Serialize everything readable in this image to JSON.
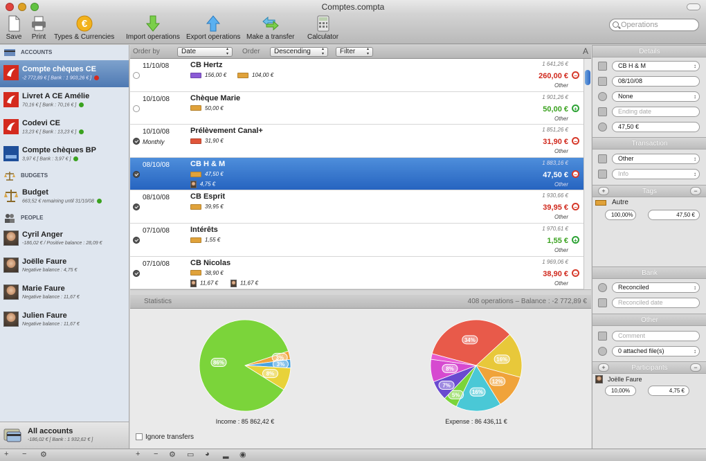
{
  "window": {
    "title": "Comptes.compta"
  },
  "toolbar": {
    "items": [
      {
        "label": "Save",
        "icon": "save-icon"
      },
      {
        "label": "Print",
        "icon": "print-icon"
      },
      {
        "label": "Types & Currencies",
        "icon": "euro-icon"
      },
      {
        "label": "Import operations",
        "icon": "import-arrow-icon"
      },
      {
        "label": "Export operations",
        "icon": "export-arrow-icon"
      },
      {
        "label": "Make a transfer",
        "icon": "transfer-arrows-icon"
      },
      {
        "label": "Calculator",
        "icon": "calculator-icon"
      }
    ],
    "search_placeholder": "Operations"
  },
  "sidebar": {
    "sections": {
      "accounts": "ACCOUNTS",
      "budgets": "BUDGETS",
      "people": "PEOPLE"
    },
    "accounts": [
      {
        "name": "Compte chèques CE",
        "sub": "-2 772,89 € [ Bank : 1 903,26 € ]",
        "status": "#d52a1e"
      },
      {
        "name": "Livret A CE Amélie",
        "sub": "70,16 € [ Bank : 70,16 € ]",
        "status": "#3aa21f"
      },
      {
        "name": "Codevi CE",
        "sub": "13,23 € [ Bank : 13,23 € ]",
        "status": "#3aa21f"
      },
      {
        "name": "Compte chèques BP",
        "sub": "3,97 € [ Bank : 3,97 € ]",
        "status": "#3aa21f"
      }
    ],
    "budgets": [
      {
        "name": "Budget",
        "sub": "663,52 € remaining until 31/10/08",
        "status": "#3aa21f"
      }
    ],
    "people": [
      {
        "name": "Cyril Anger",
        "sub": "-186,02 € / Positive balance : 28,09 €"
      },
      {
        "name": "Joëlle Faure",
        "sub": "Negative balance : 4,75 €"
      },
      {
        "name": "Marie Faure",
        "sub": "Negative balance : 11,67 €"
      },
      {
        "name": "Julien Faure",
        "sub": "Negative balance : 11,67 €"
      }
    ],
    "all_accounts": {
      "name": "All accounts",
      "sub": "-186,02 € [ Bank : 1 932,62 € ]"
    }
  },
  "list_header": {
    "order_by_label": "Order by",
    "order_by_value": "Date",
    "order_label": "Order",
    "order_value": "Descending",
    "filter_label": "Filter"
  },
  "operations": [
    {
      "date": "11/10/08",
      "recur": "",
      "title": "CB Hertz",
      "tags": [
        {
          "color": "#8b5bd6",
          "amount": "156,00 €"
        },
        {
          "color": "#e0a23a",
          "amount": "104,00 €"
        }
      ],
      "balance": "1 641,26 €",
      "amount": "260,00 €",
      "sign": "−",
      "kind": "neg",
      "category": "Other",
      "state": "open"
    },
    {
      "date": "10/10/08",
      "recur": "",
      "title": "Chèque Marie",
      "tags": [
        {
          "color": "#e0a23a",
          "amount": "50,00 €"
        }
      ],
      "balance": "1 901,26 €",
      "amount": "50,00 €",
      "sign": "+",
      "kind": "pos",
      "category": "Other",
      "state": "open"
    },
    {
      "date": "10/10/08",
      "recur": "Monthly",
      "title": "Prélèvement Canal+",
      "tags": [
        {
          "color": "#e0553a",
          "amount": "31,90 €"
        }
      ],
      "balance": "1 851,26 €",
      "amount": "31,90 €",
      "sign": "−",
      "kind": "neg",
      "category": "Other",
      "state": "done"
    },
    {
      "date": "08/10/08",
      "recur": "",
      "title": "CB H & M",
      "tags": [
        {
          "color": "#e0a23a",
          "amount": "47,50 €"
        }
      ],
      "people": [
        "4,75 €"
      ],
      "balance": "1 883,16 €",
      "amount": "47,50 €",
      "sign": "−",
      "kind": "neg",
      "category": "Other",
      "state": "done",
      "selected": true
    },
    {
      "date": "08/10/08",
      "recur": "",
      "title": "CB Esprit",
      "tags": [
        {
          "color": "#e0a23a",
          "amount": "39,95 €"
        }
      ],
      "balance": "1 930,66 €",
      "amount": "39,95 €",
      "sign": "−",
      "kind": "neg",
      "category": "Other",
      "state": "done"
    },
    {
      "date": "07/10/08",
      "recur": "",
      "title": "Intérêts",
      "tags": [
        {
          "color": "#e0a23a",
          "amount": "1,55 €"
        }
      ],
      "balance": "1 970,61 €",
      "amount": "1,55 €",
      "sign": "+",
      "kind": "pos",
      "category": "Other",
      "state": "done"
    },
    {
      "date": "07/10/08",
      "recur": "",
      "title": "CB Nicolas",
      "tags": [
        {
          "color": "#e0a23a",
          "amount": "38,90 €"
        }
      ],
      "people": [
        "11,67 €",
        "11,67 €"
      ],
      "balance": "1 969,06 €",
      "amount": "38,90 €",
      "sign": "−",
      "kind": "neg",
      "category": "Other",
      "state": "done"
    }
  ],
  "stats": {
    "title": "Statistics",
    "summary": "408 operations – Balance : -2 772,89 €",
    "income": {
      "caption": "Income : 85 862,42 €",
      "slices": [
        {
          "pct": 86,
          "label": "86%",
          "color": "#7bd43a"
        },
        {
          "pct": 3,
          "label": "3%",
          "color": "#f0a33a"
        },
        {
          "pct": 3,
          "label": "3%",
          "color": "#4aa3e0"
        },
        {
          "pct": 8,
          "label": "8%",
          "color": "#e8d23a"
        }
      ]
    },
    "expense": {
      "caption": "Expense : 86 436,11 €",
      "slices": [
        {
          "pct": 34,
          "label": "34%",
          "color": "#e85a4a"
        },
        {
          "pct": 16,
          "label": "16%",
          "color": "#e8c83a"
        },
        {
          "pct": 12,
          "label": "12%",
          "color": "#f0a33a"
        },
        {
          "pct": 16,
          "label": "16%",
          "color": "#4ac8d6"
        },
        {
          "pct": 5,
          "label": "5%",
          "color": "#7bd43a"
        },
        {
          "pct": 7,
          "label": "7%",
          "color": "#6a4ad0"
        },
        {
          "pct": 8,
          "label": "8%",
          "color": "#d64ad0"
        },
        {
          "pct": 2,
          "label": "",
          "color": "#e85ad0"
        }
      ]
    },
    "ignore_transfers": "Ignore transfers"
  },
  "inspector": {
    "details_title": "Details",
    "name": "CB H & M",
    "date": "08/10/08",
    "recurrence": "None",
    "ending_date_placeholder": "Ending date",
    "amount": "47,50 €",
    "transaction_title": "Transaction",
    "type": "Other",
    "info_placeholder": "Info",
    "tags_title": "Tags",
    "tag_name": "Autre",
    "tag_pct": "100,00%",
    "tag_amount": "47,50 €",
    "bank_title": "Bank",
    "bank_status": "Reconciled",
    "reconciled_placeholder": "Reconciled date",
    "other_title": "Other",
    "comment_placeholder": "Comment",
    "attached": "0 attached file(s)",
    "participants_title": "Participants",
    "participant_name": "Joëlle Faure",
    "participant_pct": "10,00%",
    "participant_amount": "4,75 €"
  }
}
